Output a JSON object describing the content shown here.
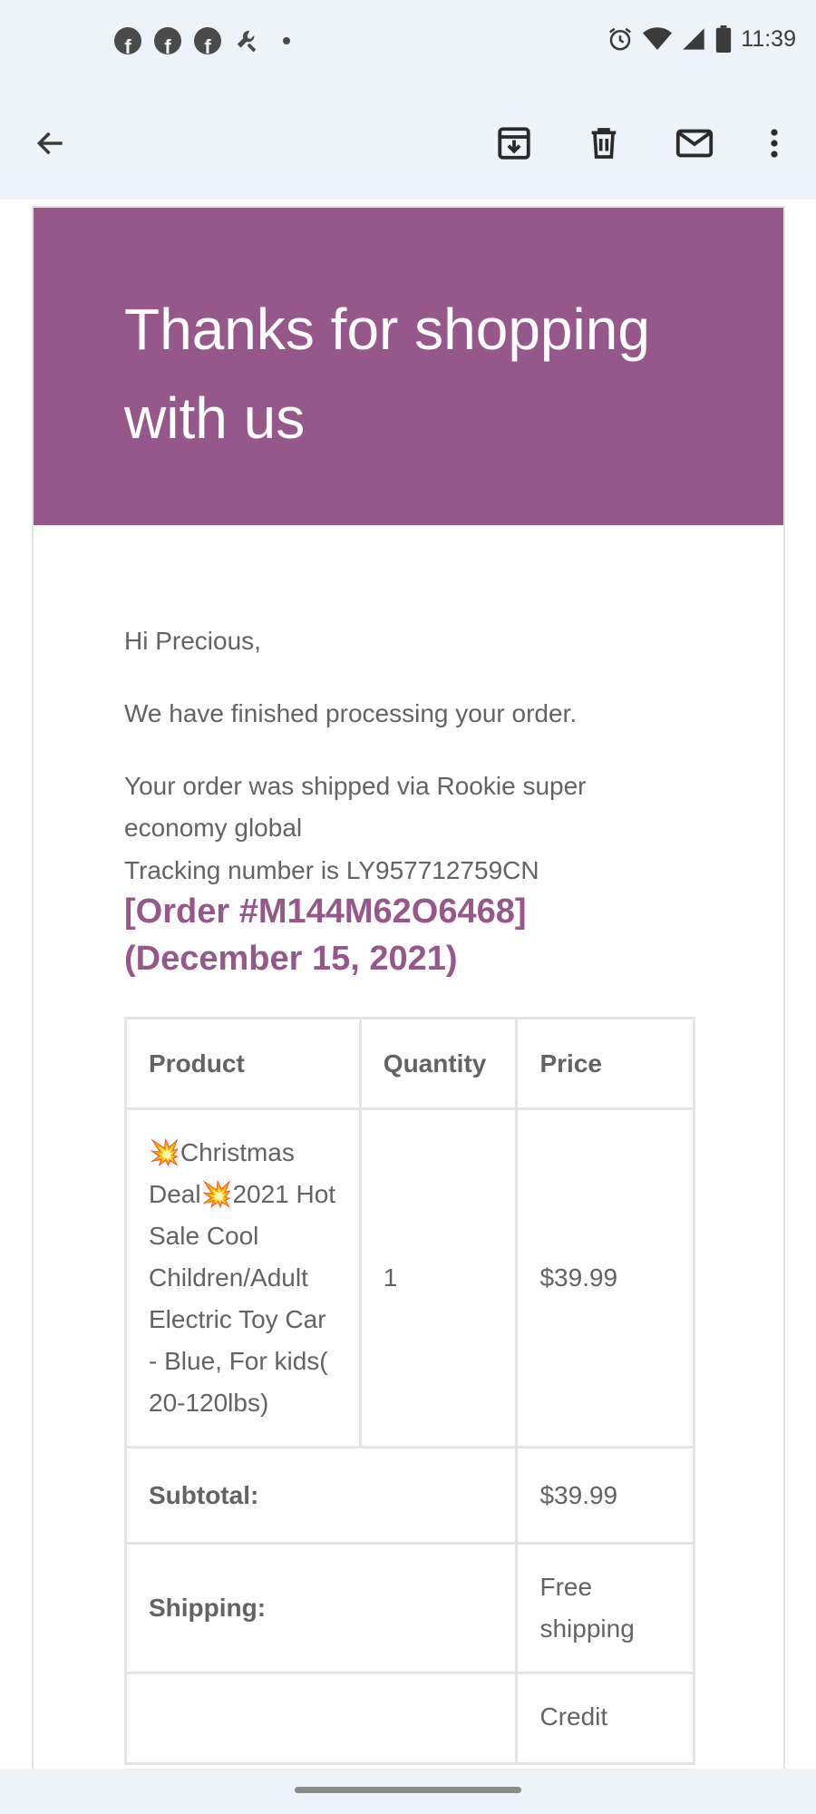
{
  "status_bar": {
    "time": "11:39",
    "left_icons": [
      "facebook-icon",
      "facebook-icon",
      "facebook-icon",
      "tools-icon",
      "dot-icon"
    ],
    "right_icons": [
      "alarm-icon",
      "wifi-icon",
      "signal-icon",
      "battery-icon"
    ],
    "fb_glyph": "f"
  },
  "app_bar": {
    "icons": [
      "back-arrow-icon",
      "archive-icon",
      "delete-icon",
      "mark-unread-icon",
      "more-vert-icon"
    ]
  },
  "email": {
    "header_title": "Thanks for shopping with us",
    "greeting": "Hi Precious,",
    "processed": "We have finished processing your order.",
    "shipped_via": "Your order was shipped via Rookie super economy global",
    "tracking": "Tracking number is LY957712759CN",
    "order_heading": "[Order #M144M62O6468] (December 15, 2021)",
    "table": {
      "headers": [
        "Product",
        "Quantity",
        "Price"
      ],
      "product_name": "💥Christmas Deal💥2021 Hot Sale Cool Children/Adult Electric Toy Car - Blue, For kids( 20-120lbs)",
      "quantity": "1",
      "price": "$39.99",
      "subtotal_label": "Subtotal:",
      "subtotal_value": "$39.99",
      "shipping_label": "Shipping:",
      "shipping_value": "Free shipping",
      "next_value_partial": "Credit"
    }
  },
  "colors": {
    "brand": "#96588a",
    "background": "#eef2f9",
    "text": "#636363"
  }
}
